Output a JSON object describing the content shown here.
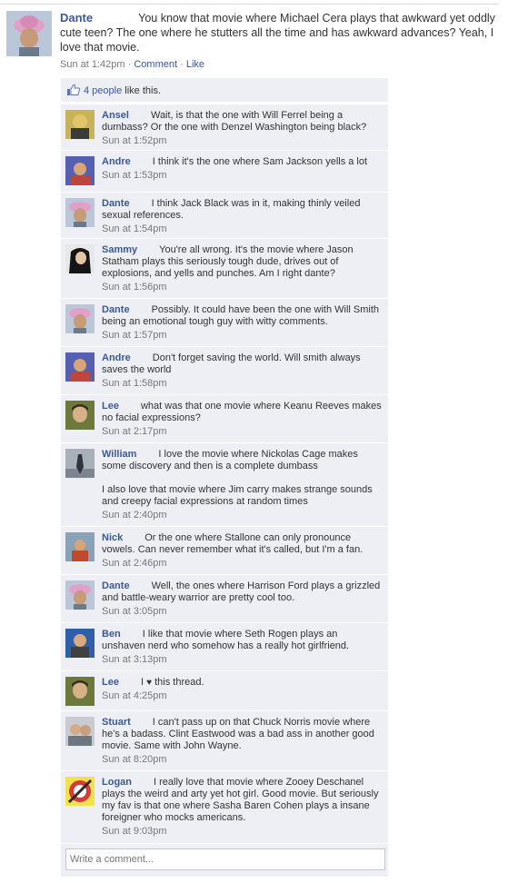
{
  "post": {
    "author": "Dante",
    "text": "You know that movie where Michael Cera plays that awkward yet oddly cute teen? The one where he stutters all the time and has awkward advances? Yeah, I love that movie.",
    "time": "Sun at 1:42pm",
    "comment_label": "Comment",
    "like_label": "Like",
    "separator": "·"
  },
  "likes": {
    "count_link": "4 people",
    "suffix": "like this."
  },
  "comments": [
    {
      "name": "Ansel",
      "text": "Wait, is that the one with Will Ferrel being a dumbass? Or the one with Denzel Washington being black?",
      "time": "Sun at 1:52pm"
    },
    {
      "name": "Andre",
      "text": "I think it's the one where Sam Jackson yells a lot",
      "time": "Sun at 1:53pm"
    },
    {
      "name": "Dante",
      "text": "I think Jack Black was in it, making thinly veiled sexual references.",
      "time": "Sun at 1:54pm"
    },
    {
      "name": "Sammy",
      "text": "You're all wrong. It's the movie where Jason Statham plays this seriously tough dude, drives out of explosions, and yells and punches. Am I right dante?",
      "time": "Sun at 1:56pm"
    },
    {
      "name": "Dante",
      "text": "Possibly. It could have been the one with Will Smith being an emotional tough guy with witty comments.",
      "time": "Sun at 1:57pm"
    },
    {
      "name": "Andre",
      "text": "Don't forget saving the world. Will smith always saves the world",
      "time": "Sun at 1:58pm"
    },
    {
      "name": "Lee",
      "text": "what was that one movie where Keanu Reeves makes no facial expressions?",
      "time": "Sun at 2:17pm"
    },
    {
      "name": "William",
      "text": "I love the movie where Nickolas Cage makes some discovery and then is a complete dumbass",
      "text2": "I also love that movie where Jim carry makes strange sounds and creepy facial expressions at random times",
      "time": "Sun at 2:40pm"
    },
    {
      "name": "Nick",
      "text": "Or the one where Stallone can only pronounce vowels. Can never remember what it's called, but I'm a fan.",
      "time": "Sun at 2:46pm"
    },
    {
      "name": "Dante",
      "text": "Well, the ones where Harrison Ford plays a grizzled and battle-weary warrior are pretty cool too.",
      "time": "Sun at 3:05pm"
    },
    {
      "name": "Ben",
      "text": "I like that movie where Seth Rogen plays an unshaven nerd who somehow has a really hot girlfriend.",
      "time": "Sun at 3:13pm"
    },
    {
      "name": "Lee",
      "text_before": "I",
      "heart": "♥",
      "text_after": "this thread.",
      "time": "Sun at 4:25pm"
    },
    {
      "name": "Stuart",
      "text": "I can't pass up on that Chuck Norris movie where he's a badass. Clint Eastwood was a bad ass in another good movie. Same with John Wayne.",
      "time": "Sun at 8:20pm"
    },
    {
      "name": "Logan",
      "text": "I really love that movie where Zooey Deschanel plays the weird and arty yet hot girl. Good movie. But seriously my fav is that one where Sasha Baren Cohen plays a insane foreigner who mocks americans.",
      "time": "Sun at 9:03pm"
    }
  ],
  "reply": {
    "placeholder": "Write a comment..."
  },
  "colors": {
    "link": "#3b5998",
    "comment_bg": "#edeff4",
    "meta": "#777777"
  }
}
